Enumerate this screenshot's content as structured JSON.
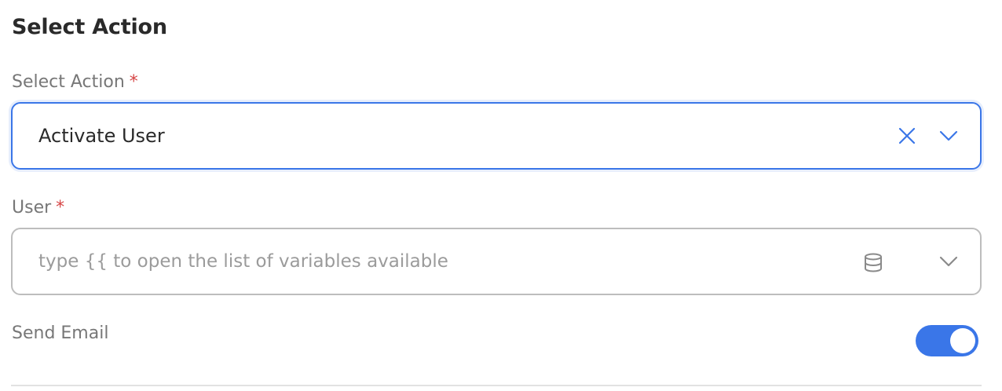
{
  "section": {
    "title": "Select Action"
  },
  "action_field": {
    "label": "Select Action",
    "required_mark": "*",
    "value": "Activate User",
    "clear_icon": "close-icon",
    "dropdown_icon": "chevron-down-icon"
  },
  "user_field": {
    "label": "User",
    "required_mark": "*",
    "placeholder": "type {{ to open the list of variables available",
    "variables_icon": "database-icon",
    "dropdown_icon": "chevron-down-icon"
  },
  "send_email": {
    "label": "Send Email",
    "enabled": true
  },
  "colors": {
    "accent": "#3a76e8",
    "required": "#d64545",
    "label_text": "#777777",
    "placeholder_text": "#9b9b9b"
  }
}
